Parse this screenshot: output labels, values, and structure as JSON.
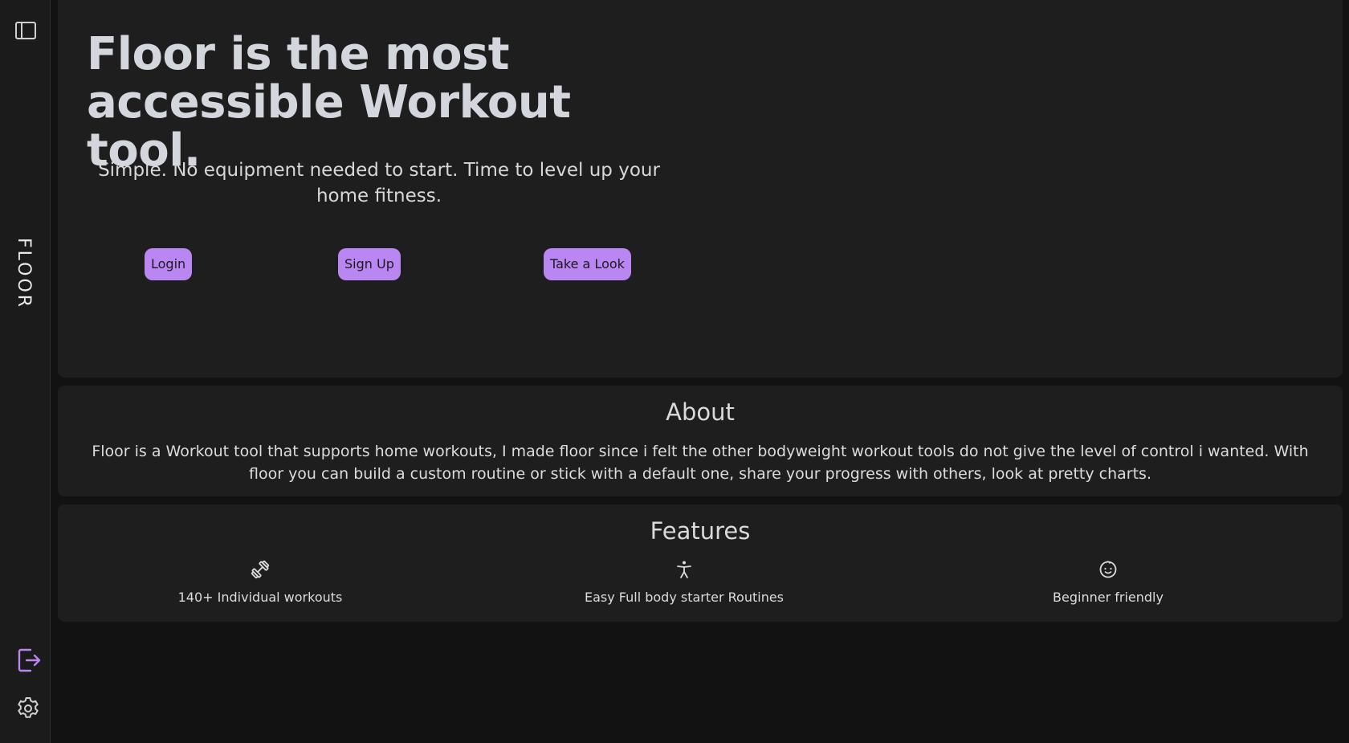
{
  "sidebar": {
    "brand": "FLOOR",
    "toggle_icon": "sidebar-panel-icon",
    "logout_icon": "logout-icon",
    "settings_icon": "gear-icon",
    "accent_color": "#b986f2"
  },
  "hero": {
    "title": "Floor is the most accessible Workout tool.",
    "subtitle": "Simple. No equipment needed to start. Time to level up your home fitness.",
    "buttons": {
      "login": "Login",
      "signup": "Sign Up",
      "look": "Take a Look"
    }
  },
  "about": {
    "title": "About",
    "text": "Floor is a Workout tool that supports home workouts, I made floor since i felt the other bodyweight workout tools do not give the level of control i wanted. With floor you can build a custom routine or stick with a default one, share your progress with others, look at pretty charts."
  },
  "features": {
    "title": "Features",
    "items": [
      {
        "icon": "dumbbell-icon",
        "label": "140+ Individual workouts"
      },
      {
        "icon": "person-icon",
        "label": "Easy Full body starter Routines"
      },
      {
        "icon": "baby-face-icon",
        "label": "Beginner friendly"
      }
    ]
  }
}
